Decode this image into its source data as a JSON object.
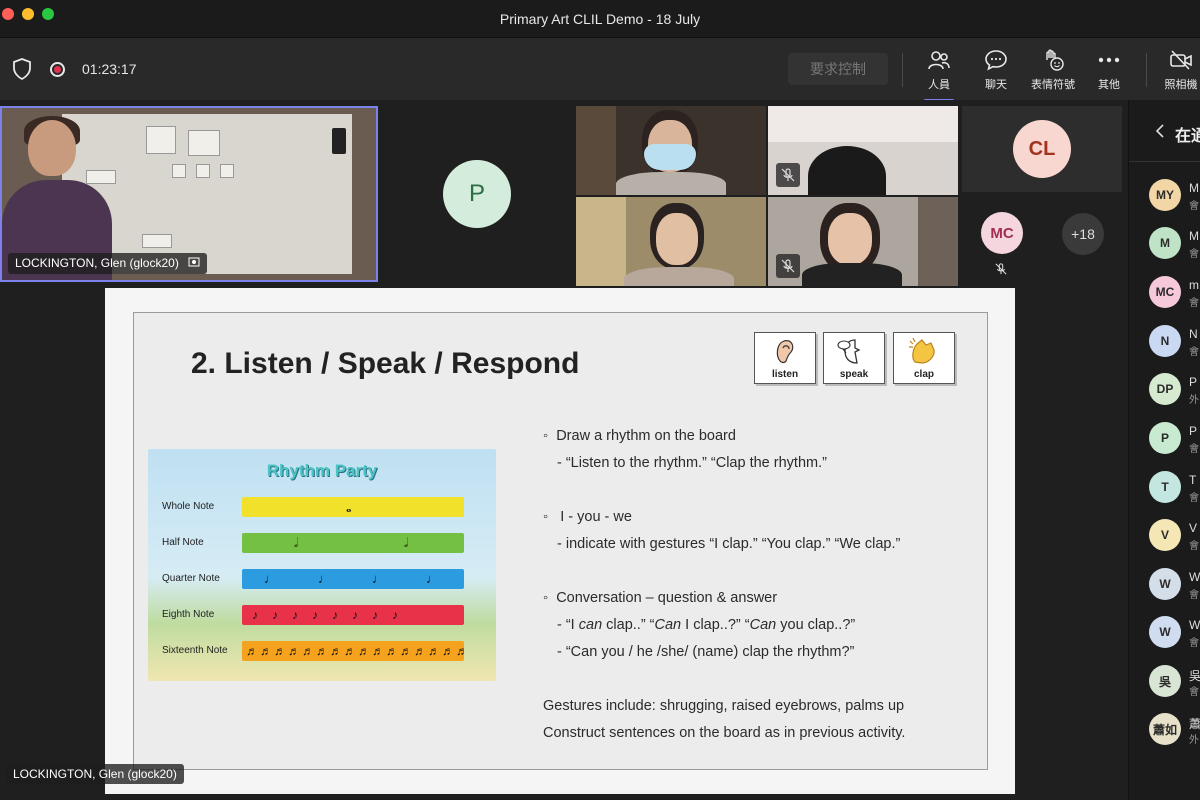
{
  "window": {
    "title": "Primary Art CLIL Demo - 18 July"
  },
  "toolbar": {
    "timer": "01:23:17",
    "request_control": "要求控制",
    "tools": [
      {
        "label": "人員",
        "icon": "people-icon"
      },
      {
        "label": "聊天",
        "icon": "chat-icon"
      },
      {
        "label": "表情符號",
        "icon": "emoji-icon"
      },
      {
        "label": "其他",
        "icon": "more-icon"
      },
      {
        "label": "照相機",
        "icon": "camera-off-icon"
      }
    ]
  },
  "videos": {
    "main_name": "LOCKINGTON, Glen (glock20)",
    "avatar_p": "P",
    "avatar_cl": "CL",
    "avatar_mc": "MC",
    "overflow": "+18"
  },
  "slide": {
    "title": "2. Listen / Speak / Respond",
    "cards": [
      "listen",
      "speak",
      "clap"
    ],
    "rhythm": {
      "title": "Rhythm Party",
      "rows": [
        "Whole Note",
        "Half Note",
        "Quarter Note",
        "Eighth Note",
        "Sixteenth Note"
      ]
    },
    "lines": {
      "b1": "Draw a rhythm on the board",
      "b1_sub": "- “Listen to the rhythm.”   “Clap the rhythm.”",
      "b2": "I  - you  -  we",
      "b2_sub": "- indicate with gestures “I clap.” “You clap.” “We clap.”",
      "b3": "Conversation – question & answer",
      "b3_sub1_a": "- “I ",
      "b3_sub1_b": "can",
      "b3_sub1_c": " clap..” “",
      "b3_sub1_d": "Can",
      "b3_sub1_e": " I clap..?” “",
      "b3_sub1_f": "Can",
      "b3_sub1_g": " you clap..?”",
      "b3_sub2": "-  “Can you / he /she/ (name) clap the rhythm?”",
      "g1": "Gestures include: shrugging, raised eyebrows, palms up",
      "g2": "Construct sentences on the board as in previous activity."
    },
    "presenter": "LOCKINGTON, Glen (glock20)"
  },
  "panel": {
    "header": "在通",
    "participants": [
      {
        "initials": "MY",
        "name": "M",
        "sub": "會",
        "color": "#f2d6a6"
      },
      {
        "initials": "M",
        "name": "M",
        "sub": "會",
        "color": "#bfe3c6"
      },
      {
        "initials": "MC",
        "name": "m",
        "sub": "會",
        "color": "#f5c9d9"
      },
      {
        "initials": "N",
        "name": "N",
        "sub": "會",
        "color": "#c9d9f2"
      },
      {
        "initials": "DP",
        "name": "P",
        "sub": "外",
        "color": "#d6ead0"
      },
      {
        "initials": "P",
        "name": "P",
        "sub": "會",
        "color": "#c8ead0"
      },
      {
        "initials": "T",
        "name": "T",
        "sub": "會",
        "color": "#c4e6e0"
      },
      {
        "initials": "V",
        "name": "V",
        "sub": "會",
        "color": "#f5e7b5"
      },
      {
        "initials": "W",
        "name": "W",
        "sub": "會",
        "color": "#d4dee9"
      },
      {
        "initials": "W",
        "name": "W",
        "sub": "會",
        "color": "#d0dcf0"
      },
      {
        "initials": "吳",
        "name": "吳",
        "sub": "會",
        "color": "#d8e5d4"
      },
      {
        "initials": "蕭如",
        "name": "蕭",
        "sub": "外",
        "color": "#e6e1c8"
      }
    ]
  }
}
